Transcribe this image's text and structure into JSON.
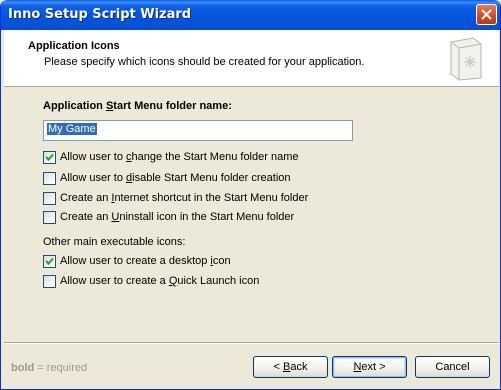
{
  "window": {
    "title": "Inno Setup Script Wizard",
    "close_icon": "close-icon"
  },
  "header": {
    "title": "Application Icons",
    "subtitle": "Please specify which icons should be created for your application.",
    "icon": "wizard-book-icon"
  },
  "form": {
    "folder_label_pre": "Application ",
    "folder_label_u": "S",
    "folder_label_post": "tart Menu folder name:",
    "folder_value": "My Game",
    "checkboxes": [
      {
        "pre": "Allow user to ",
        "u": "c",
        "post": "hange the Start Menu folder name",
        "checked": true
      },
      {
        "pre": "Allow user to ",
        "u": "d",
        "post": "isable Start Menu folder creation",
        "checked": false
      },
      {
        "pre": "Create an ",
        "u": "I",
        "post": "nternet shortcut in the Start Menu folder",
        "checked": false
      },
      {
        "pre": "Create an ",
        "u": "U",
        "post": "ninstall icon in the Start Menu folder",
        "checked": false
      }
    ],
    "other_label": "Other main executable icons:",
    "other_checkboxes": [
      {
        "pre": "Allow user to create a desktop ",
        "u": "i",
        "post": "con",
        "checked": true
      },
      {
        "pre": "Allow user to create a ",
        "u": "Q",
        "post": "uick Launch icon",
        "checked": false
      }
    ]
  },
  "footer": {
    "note_bold": "bold",
    "note_rest": " = required",
    "back_pre": "< ",
    "back_u": "B",
    "back_post": "ack",
    "next_u": "N",
    "next_post": "ext >",
    "cancel": "Cancel"
  }
}
